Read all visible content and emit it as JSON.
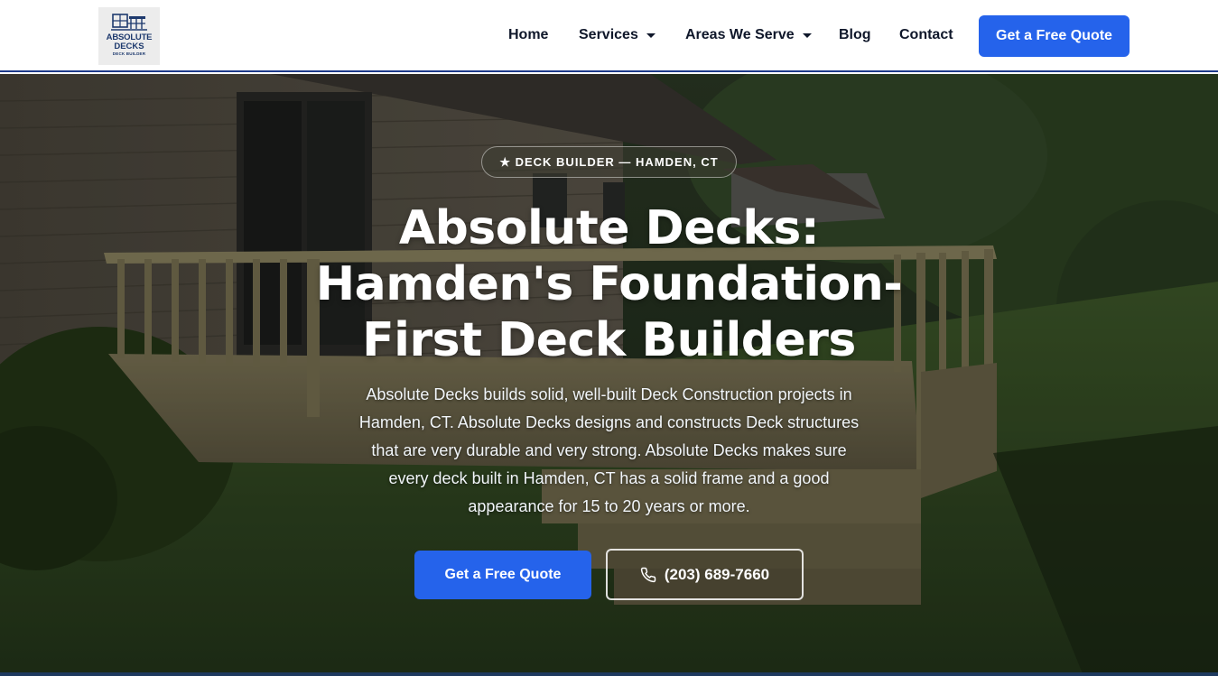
{
  "brand": {
    "logo_line1": "ABSOLUTE",
    "logo_line2": "DECKS",
    "logo_line3": "DECK BUILDER"
  },
  "nav": {
    "items": [
      {
        "label": "Home",
        "has_dropdown": false
      },
      {
        "label": "Services",
        "has_dropdown": true
      },
      {
        "label": "Areas We Serve",
        "has_dropdown": true
      },
      {
        "label": "Blog",
        "has_dropdown": false
      },
      {
        "label": "Contact",
        "has_dropdown": false
      }
    ],
    "cta_label": "Get a Free Quote"
  },
  "hero": {
    "badge": "★ DECK BUILDER — HAMDEN, CT",
    "title_line1": "Absolute Decks:",
    "title_line2": "Hamden's Foundation-",
    "title_line3": "First Deck Builders",
    "description": "Absolute Decks builds solid, well-built Deck Construction projects in Hamden, CT. Absolute Decks designs and constructs Deck structures that are very durable and very strong. Absolute Decks makes sure every deck built in Hamden, CT has a solid frame and a good appearance for 15 to 20 years or more.",
    "primary_cta": "Get a Free Quote",
    "phone": "(203) 689-7660",
    "phone_icon": "phone-icon"
  },
  "colors": {
    "accent": "#2563eb",
    "header_border": "#1e3a8a",
    "text_dark": "#0f172a"
  }
}
